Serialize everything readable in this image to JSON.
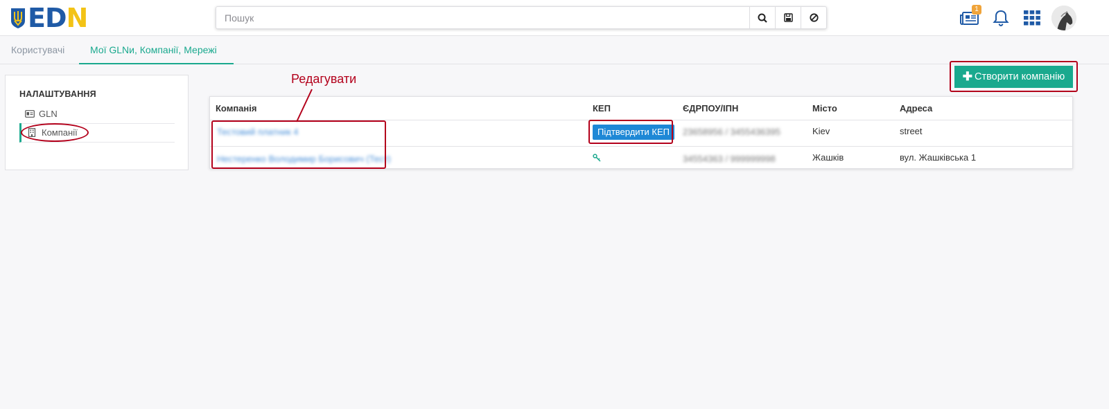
{
  "header": {
    "logo_text_1": "ED",
    "logo_text_2": "N",
    "search_placeholder": "Пошук",
    "news_badge": "1"
  },
  "tabs": [
    {
      "label": "Користувачі",
      "active": false
    },
    {
      "label": "Мої GLNи, Компанії, Мережі",
      "active": true
    }
  ],
  "settings": {
    "title": "НАЛАШТУВАННЯ",
    "items": [
      {
        "label": "GLN",
        "icon": "id-card-icon",
        "active": false
      },
      {
        "label": "Компанії",
        "icon": "building-icon",
        "active": true
      }
    ]
  },
  "create_button_label": "Створити компанію",
  "table": {
    "columns": [
      "Компанія",
      "КЕП",
      "ЄДРПОУ/ІПН",
      "Місто",
      "Адреса"
    ],
    "rows": [
      {
        "company": "Тестовий платник 4",
        "kep": "Підтвердити КЕП",
        "edrpou": "23658956 / 3455436395",
        "city": "Kiev",
        "address": "street"
      },
      {
        "company": "Нестеренко Володимир Борисович (Тест)",
        "kep": "",
        "edrpou": "34554363 / 999999998",
        "city": "Жашків",
        "address": "вул. Жашківська 1"
      }
    ]
  },
  "annotation": {
    "label": "Редагувати"
  },
  "colors": {
    "accent": "#1aa98e",
    "link": "#4a90d9",
    "kep_button": "#1e88d6",
    "annotation": "#b3001b",
    "badge": "#f0a43a"
  }
}
